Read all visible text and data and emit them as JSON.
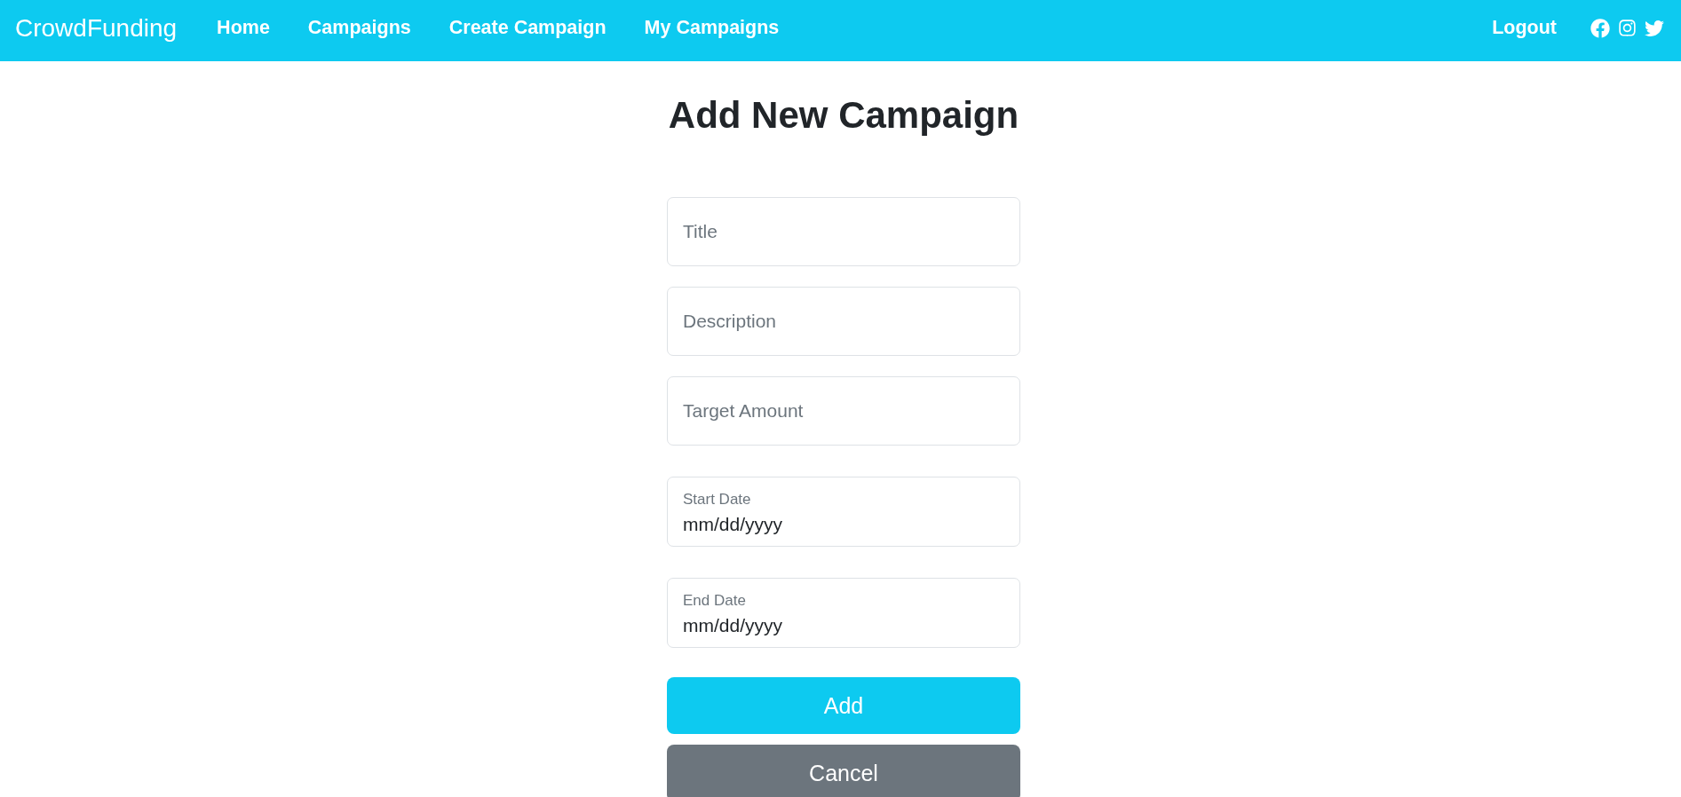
{
  "navbar": {
    "brand": "CrowdFunding",
    "links": [
      {
        "label": "Home"
      },
      {
        "label": "Campaigns"
      },
      {
        "label": "Create Campaign"
      },
      {
        "label": "My Campaigns"
      }
    ],
    "logout": "Logout"
  },
  "form": {
    "title": "Add New Campaign",
    "fields": [
      {
        "kind": "text",
        "placeholder": "Title"
      },
      {
        "kind": "text",
        "placeholder": "Description"
      },
      {
        "kind": "text",
        "placeholder": "Target Amount"
      },
      {
        "kind": "date",
        "label": "Start Date",
        "placeholder": "mm/dd/yyyy"
      },
      {
        "kind": "date",
        "label": "End Date",
        "placeholder": "mm/dd/yyyy"
      }
    ],
    "buttons": [
      {
        "kind": "primary",
        "label": "Add"
      },
      {
        "kind": "secondary",
        "label": "Cancel"
      }
    ]
  }
}
